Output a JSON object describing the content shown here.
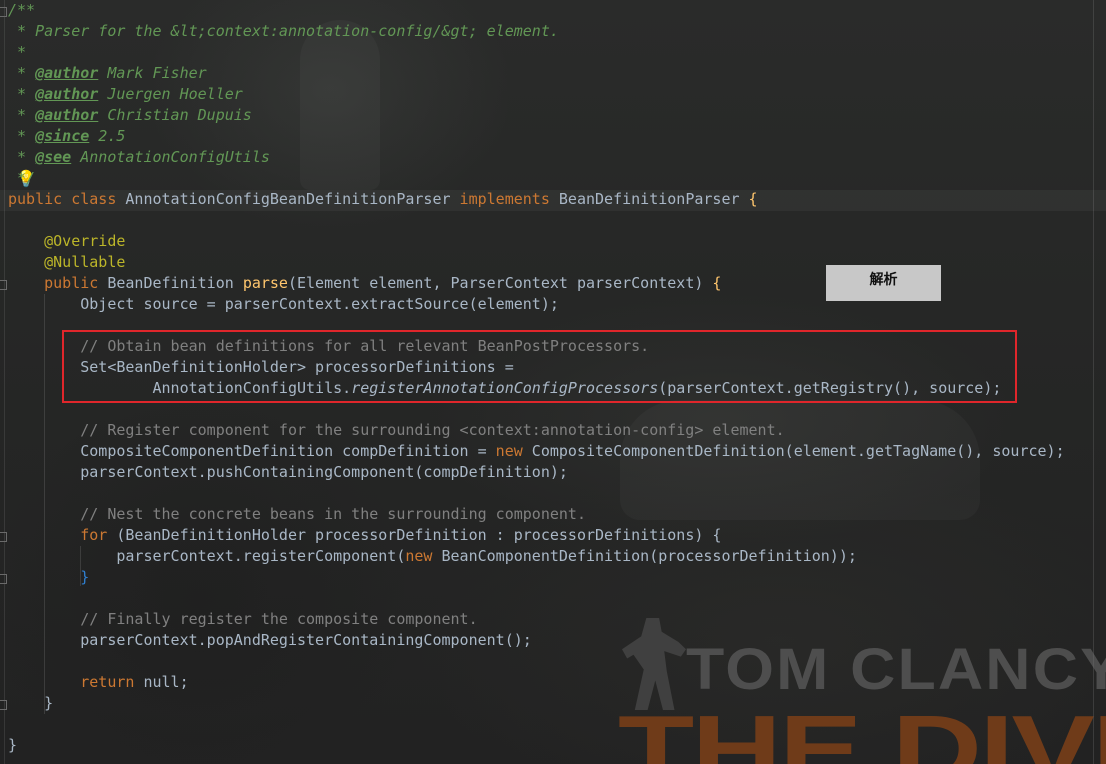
{
  "annotation_button": {
    "label": "解析"
  },
  "background": {
    "brand_line1": "TOM CLANCY'",
    "brand_line2": "THE DIVIS"
  },
  "colors": {
    "keyword": "#cc7832",
    "annotation": "#bbb529",
    "method": "#ffc66d",
    "comment": "#808080",
    "javadoc": "#629755",
    "text": "#a9b7c6",
    "highlight_border": "#e0262b"
  },
  "code": {
    "doc_open": "/**",
    "doc_desc_prefix": " * Parser for the ",
    "doc_desc_value": "&lt;context:annotation-config/&gt; element.",
    "doc_blank": " *",
    "doc_star": " * ",
    "author_tag": "@author",
    "author1": " Mark Fisher",
    "author2": " Juergen Hoeller",
    "author3": " Christian Dupuis",
    "since_tag": "@since",
    "since_value": " 2.5",
    "see_tag": "@see",
    "see_value": " AnnotationConfigUtils",
    "doc_close": " */",
    "class_kw": "public class",
    "class_name": "AnnotationConfigBeanDefinitionParser",
    "implements_kw": "implements",
    "interface_name": "BeanDefinitionParser",
    "brace_open": "{",
    "brace_close": "}",
    "override": "@Override",
    "nullable": "@Nullable",
    "public_kw": "public",
    "return_type": "BeanDefinition",
    "method_name": "parse",
    "params": "(Element element, ParserContext parserContext)",
    "line_source": "Object source = parserContext.extractSource(element);",
    "comment_obtain": "// Obtain bean definitions for all relevant BeanPostProcessors.",
    "set_decl": "Set<BeanDefinitionHolder> processorDefinitions =",
    "register_class": "AnnotationConfigUtils.",
    "register_method": "registerAnnotationConfigProcessors",
    "register_args": "(parserContext.getRegistry(), source);",
    "comment_register": "// Register component for the surrounding <context:annotation-config> element.",
    "comp_decl": "CompositeComponentDefinition compDefinition = ",
    "new_kw": "new",
    "comp_ctor": " CompositeComponentDefinition(element.getTagName(), source);",
    "push_call": "parserContext.pushContainingComponent(compDefinition);",
    "comment_nest": "// Nest the concrete beans in the surrounding component.",
    "for_kw": "for",
    "for_header": " (BeanDefinitionHolder processorDefinition : processorDefinitions) {",
    "register_component": "parserContext.registerComponent(",
    "bean_component": " BeanComponentDefinition(processorDefinition));",
    "inner_close": "}",
    "comment_finally": "// Finally register the composite component.",
    "pop_call": "parserContext.popAndRegisterContainingComponent();",
    "return_kw": "return",
    "null_value": " null;",
    "method_close": "}",
    "class_close": "}"
  }
}
